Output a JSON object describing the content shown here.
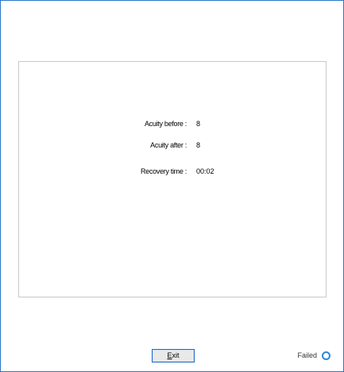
{
  "results": {
    "rows": [
      {
        "label": "Acuity before :",
        "value": "8"
      },
      {
        "label": "Acuity after :",
        "value": "8"
      },
      {
        "label": "Recovery time :",
        "value": "00:02"
      }
    ]
  },
  "footer": {
    "exit_label_accel": "E",
    "exit_label_rest": "xit",
    "status_label": "Failed",
    "status_icon": "status-circle-icon"
  },
  "colors": {
    "window_border": "#2b79c8",
    "button_border": "#1e68c8",
    "status_icon": "#2f86d8"
  }
}
